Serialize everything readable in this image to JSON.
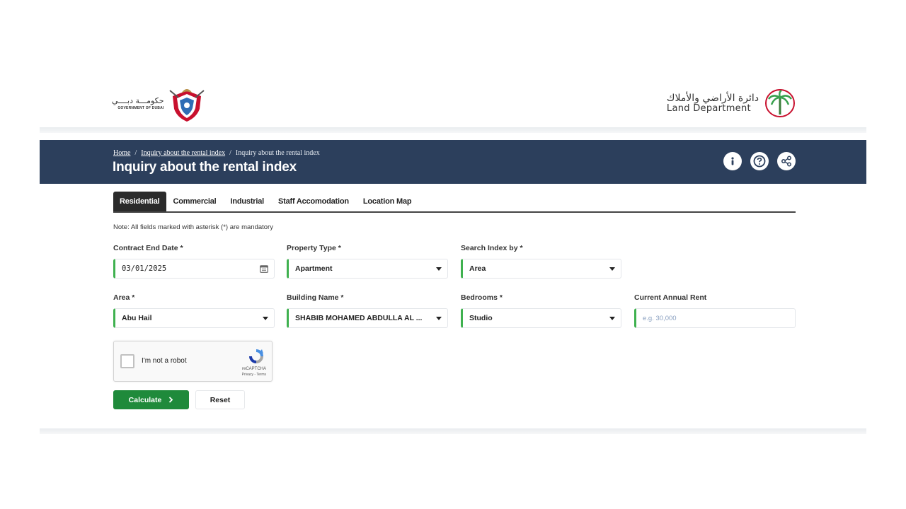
{
  "header": {
    "gov_logo_ar": "حكومـــة دبــــي",
    "gov_logo_en": "GOVERNMENT OF DUBAI",
    "ld_logo_ar": "دائرة الأراضي والأملاك",
    "ld_logo_en": "Land Department"
  },
  "breadcrumb": {
    "items": [
      "Home",
      "Inquiry about the rental index",
      "Inquiry about the rental index"
    ],
    "separator": "/"
  },
  "page": {
    "title": "Inquiry about the rental index",
    "banner_color": "#2c3f5c"
  },
  "banner_icons": [
    "info-icon",
    "help-icon",
    "share-icon"
  ],
  "tabs": [
    {
      "label": "Residential",
      "active": true
    },
    {
      "label": "Commercial",
      "active": false
    },
    {
      "label": "Industrial",
      "active": false
    },
    {
      "label": "Staff Accomodation",
      "active": false
    },
    {
      "label": "Location Map",
      "active": false
    }
  ],
  "note": "Note: All fields marked with asterisk (*) are mandatory",
  "form": {
    "contract_end_date": {
      "label": "Contract End Date *",
      "value": "03/01/2025"
    },
    "property_type": {
      "label": "Property Type *",
      "value": "Apartment"
    },
    "search_index_by": {
      "label": "Search Index by *",
      "value": "Area"
    },
    "area": {
      "label": "Area *",
      "value": "Abu Hail"
    },
    "building_name": {
      "label": "Building Name *",
      "value": "SHABIB MOHAMED ABDULLA AL ..."
    },
    "bedrooms": {
      "label": "Bedrooms *",
      "value": "Studio"
    },
    "current_annual_rent": {
      "label": "Current Annual Rent",
      "value": "",
      "placeholder": "e.g. 30,000"
    }
  },
  "captcha": {
    "label": "I'm not a robot",
    "brand": "reCAPTCHA",
    "links": "Privacy - Terms"
  },
  "buttons": {
    "calculate": "Calculate",
    "calculate_icon": "chevron-right-icon",
    "reset": "Reset"
  },
  "colors": {
    "accent_green": "#1f8a3b",
    "field_border_green": "#3fb14f"
  }
}
